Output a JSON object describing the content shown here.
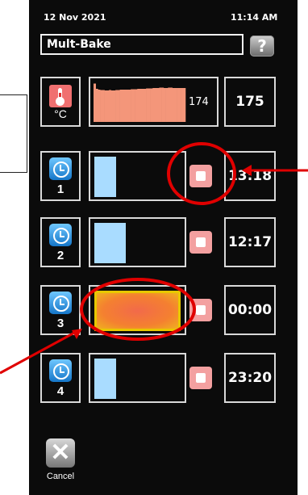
{
  "header": {
    "date": "12 Nov 2021",
    "time": "11:14 AM"
  },
  "title": "Mult-Bake",
  "help_label": "?",
  "temperature": {
    "unit": "°C",
    "current": "174",
    "setpoint": "175",
    "history": [
      0.95,
      0.82,
      0.8,
      0.79,
      0.79,
      0.78,
      0.78,
      0.79,
      0.78,
      0.78,
      0.79,
      0.79,
      0.8,
      0.8,
      0.8,
      0.8,
      0.8,
      0.81,
      0.81,
      0.81,
      0.82,
      0.82,
      0.82,
      0.82,
      0.83,
      0.83,
      0.83,
      0.84,
      0.84,
      0.84,
      0.85,
      0.85,
      0.84,
      0.84,
      0.85,
      0.85,
      0.84,
      0.84,
      0.84,
      0.84,
      0.84,
      0.84
    ]
  },
  "timers": [
    {
      "number": "1",
      "time": "13:18",
      "level": 0.25,
      "state": "blue",
      "stop_visible": true
    },
    {
      "number": "2",
      "time": "12:17",
      "level": 0.36,
      "state": "blue",
      "stop_visible": true
    },
    {
      "number": "3",
      "time": "00:00",
      "level": 1.0,
      "state": "done",
      "stop_visible": true
    },
    {
      "number": "4",
      "time": "23:20",
      "level": 0.25,
      "state": "blue",
      "stop_visible": true
    }
  ],
  "cancel_label": "Cancel",
  "colors": {
    "timer_blue": "#a9dcff",
    "done_orange": "#f46a3b",
    "stop_pink": "#f3a0a0",
    "annotation_red": "#e00000"
  }
}
